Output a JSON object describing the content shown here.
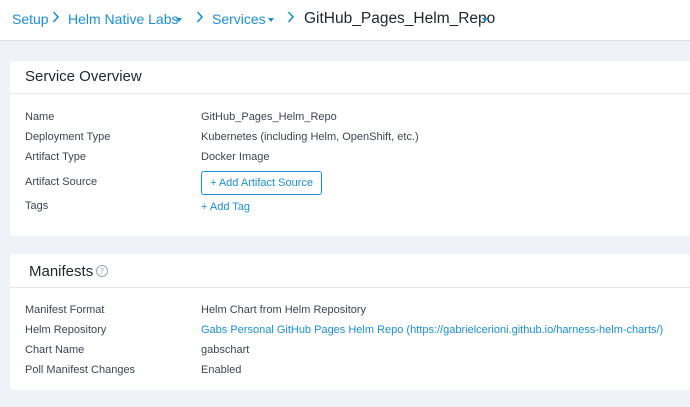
{
  "breadcrumb": {
    "setup": "Setup",
    "application": "Helm Native Labs",
    "services": "Services",
    "current": "GitHub_Pages_Helm_Repo"
  },
  "icons": {
    "dropdown": "chevron-down-icon",
    "separator": "chevron-right-icon",
    "help": "help-circle-icon"
  },
  "colors": {
    "link": "#1b8fd6",
    "background": "#eff2f6",
    "card": "#ffffff"
  },
  "service_overview": {
    "title": "Service Overview",
    "rows": {
      "name": {
        "label": "Name",
        "value": "GitHub_Pages_Helm_Repo"
      },
      "deployment_type": {
        "label": "Deployment Type",
        "value": "Kubernetes (including Helm, OpenShift, etc.)"
      },
      "artifact_type": {
        "label": "Artifact Type",
        "value": "Docker Image"
      },
      "artifact_source": {
        "label": "Artifact Source",
        "button": "+ Add Artifact Source"
      },
      "tags": {
        "label": "Tags",
        "link": "+ Add Tag"
      }
    }
  },
  "manifests": {
    "title": "Manifests",
    "help_glyph": "?",
    "rows": {
      "format": {
        "label": "Manifest Format",
        "value": "Helm Chart from Helm Repository"
      },
      "repository": {
        "label": "Helm Repository",
        "value": "Gabs Personal GitHub Pages Helm Repo (https://gabrielcerioni.github.io/harness-helm-charts/)"
      },
      "chart_name": {
        "label": "Chart Name",
        "value": "gabschart"
      },
      "poll": {
        "label": "Poll Manifest Changes",
        "value": "Enabled"
      }
    }
  }
}
